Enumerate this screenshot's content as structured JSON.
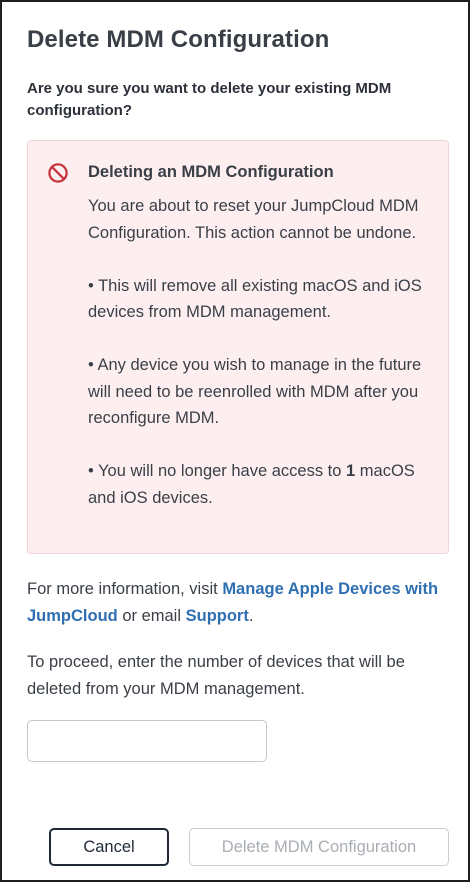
{
  "dialog": {
    "title": "Delete MDM Configuration",
    "question": "Are you sure you want to delete your existing MDM configuration?"
  },
  "warning": {
    "icon": "prohibited-icon",
    "icon_color": "#c7353f",
    "heading": "Deleting an MDM Configuration",
    "intro": "You are about to reset your JumpCloud MDM Configuration. This action cannot be undone.",
    "bullet_1": "• This will remove all existing macOS and iOS devices from MDM management.",
    "bullet_2": "• Any device you wish to manage in the future will need to be reenrolled with MDM after you reconfigure MDM.",
    "bullet_3_prefix": "• You will no longer have access to ",
    "bullet_3_count": "1",
    "bullet_3_suffix": " macOS and iOS devices."
  },
  "info": {
    "prefix": "For more information, visit ",
    "link_apple": "Manage Apple Devices with JumpCloud",
    "middle": " or email ",
    "link_support": "Support",
    "suffix": "."
  },
  "proceed": {
    "text": "To proceed, enter the number of devices that will be deleted from your MDM management.",
    "input_value": "",
    "input_placeholder": ""
  },
  "buttons": {
    "cancel_label": "Cancel",
    "delete_label": "Delete MDM Configuration"
  },
  "colors": {
    "link": "#2f6fb2",
    "warning_background": "#fdeff0",
    "warning_border": "#f1d4d6",
    "disabled_text": "#a9aeb4"
  }
}
